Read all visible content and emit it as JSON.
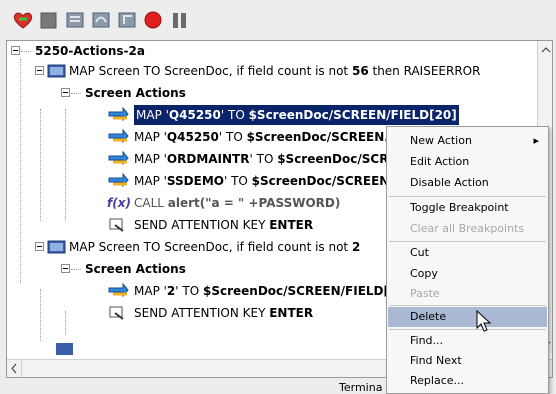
{
  "toolbar": {
    "buttons": [
      {
        "icon": "heart-run-icon",
        "color": "#d9302a"
      },
      {
        "icon": "stop-square-icon",
        "color": "#7a7a7a"
      },
      {
        "icon": "step-into-icon",
        "color": "#6d7f8f"
      },
      {
        "icon": "step-over-icon",
        "color": "#6d7f8f"
      },
      {
        "icon": "step-out-icon",
        "color": "#6d7f8f"
      },
      {
        "icon": "record-icon",
        "color": "#e02020"
      },
      {
        "icon": "pause-icon",
        "color": "#6a6a6a"
      }
    ]
  },
  "tree": {
    "root": "5250-Actions-2a",
    "node1": {
      "pre": "MAP Screen TO ScreenDoc, if field count is not ",
      "num": "56",
      "post": " then RAISEERROR"
    },
    "screen_actions_1": "Screen Actions",
    "map1": {
      "pre": "MAP '",
      "q": "Q45250",
      "mid": "' TO ",
      "t": "$ScreenDoc/SCREEN/FIELD[20]"
    },
    "map2": {
      "pre": "MAP '",
      "q": "Q45250",
      "mid": "' TO ",
      "t": "$ScreenDoc/SCREEN."
    },
    "map3": {
      "pre": "MAP '",
      "q": "ORDMAINTR",
      "mid": "' TO ",
      "t": "$ScreenDoc/SCR"
    },
    "map4": {
      "pre": "MAP '",
      "q": "SSDEMO",
      "mid": "' TO ",
      "t": "$ScreenDoc/SCREEN"
    },
    "call": {
      "fx": "f(x)",
      "pre": "CALL ",
      "name": "alert(\"a = \" +PASSWORD)"
    },
    "send1": {
      "pre": "SEND ATTENTION KEY ",
      "key": "ENTER"
    },
    "node2": {
      "pre": "MAP Screen TO ScreenDoc, if field count is not ",
      "num": "2"
    },
    "screen_actions_2": "Screen Actions",
    "map5": {
      "pre": "MAP '",
      "q": "2",
      "mid": "' TO ",
      "t": "$ScreenDoc/SCREEN/FIELD["
    },
    "send2": {
      "pre": "SEND ATTENTION KEY ",
      "key": "ENTER"
    }
  },
  "status_text": "Termina",
  "context_menu": {
    "items": [
      {
        "label": "New Action",
        "submenu": "▸",
        "disabled": false
      },
      {
        "label": "Edit Action",
        "disabled": false
      },
      {
        "label": "Disable Action",
        "disabled": false
      },
      {
        "label": "Toggle Breakpoint",
        "disabled": false
      },
      {
        "label": "Clear all Breakpoints",
        "disabled": true
      },
      {
        "label": "Cut",
        "disabled": false
      },
      {
        "label": "Copy",
        "disabled": false
      },
      {
        "label": "Paste",
        "disabled": true
      },
      {
        "label": "Delete",
        "disabled": false,
        "highlighted": true
      },
      {
        "label": "Find...",
        "disabled": false
      },
      {
        "label": "Find Next",
        "disabled": false
      },
      {
        "label": "Replace...",
        "disabled": false
      }
    ]
  }
}
